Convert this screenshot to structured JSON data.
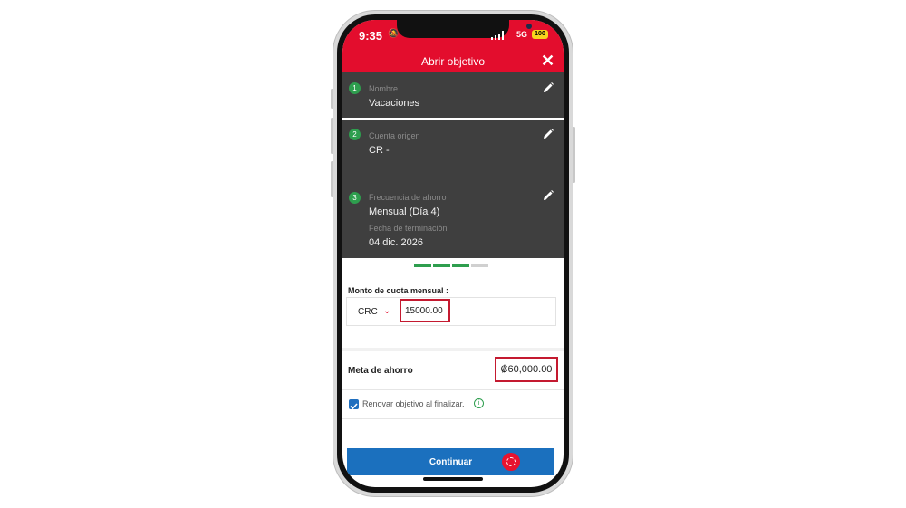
{
  "status_bar": {
    "time": "9:35",
    "network": "5G",
    "battery": "100"
  },
  "header": {
    "title": "Abrir objetivo",
    "close_icon": "close-icon"
  },
  "steps": [
    {
      "number": "1",
      "label": "Nombre",
      "value": "Vacaciones"
    },
    {
      "number": "2",
      "label": "Cuenta origen",
      "value": "CR -"
    },
    {
      "number": "3",
      "label": "Frecuencia de ahorro",
      "value": "Mensual (Día 4)",
      "sub_label": "Fecha de terminación",
      "sub_value": "04 dic. 2026"
    }
  ],
  "progress": {
    "completed_segments": 3,
    "total_segments": 4
  },
  "form": {
    "amount_label": "Monto de cuota mensual :",
    "currency": "CRC",
    "amount_value": "15000.00",
    "goal_label": "Meta de ahorro",
    "goal_value": "₡60,000.00",
    "renew_label": "Renovar objetivo al finalizar.",
    "renew_checked": true
  },
  "actions": {
    "continue_label": "Continuar"
  },
  "colors": {
    "brand_red": "#e30d2d",
    "card_dark": "#3f3f3f",
    "step_green": "#2e9e4e",
    "button_blue": "#1b70be"
  }
}
